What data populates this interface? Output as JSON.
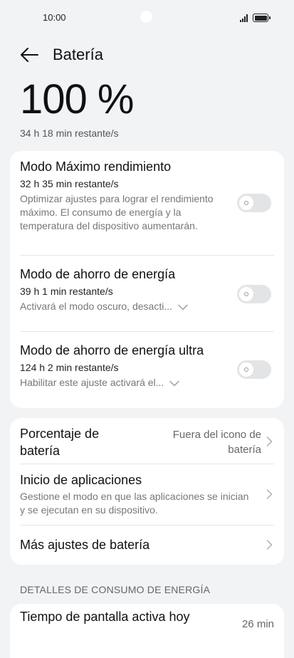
{
  "status_bar": {
    "time": "10:00"
  },
  "header": {
    "title": "Batería"
  },
  "battery": {
    "percent_label": "100 %",
    "remaining": "34 h 18 min restante/s",
    "level_percent": 100
  },
  "modes": [
    {
      "title": "Modo Máximo rendimiento",
      "remaining": "32 h 35 min restante/s",
      "description": "Optimizar ajustes para lograr el rendimiento máximo. El consumo de energía y la temperatura del dispositivo aumentarán.",
      "enabled": false
    },
    {
      "title": "Modo de ahorro de energía",
      "remaining": "39 h 1 min restante/s",
      "description": "Activará el modo oscuro, desacti...",
      "enabled": false
    },
    {
      "title": "Modo de ahorro de energía ultra",
      "remaining": "124 h 2 min restante/s",
      "description": "Habilitar este ajuste activará el...",
      "enabled": false
    }
  ],
  "settings": {
    "percentage": {
      "title": "Porcentaje de batería",
      "value": "Fuera del icono de batería"
    },
    "app_launch": {
      "title": "Inicio de aplicaciones",
      "description": "Gestione el modo en que las aplicaciones se inician y se ejecutan en su dispositivo."
    },
    "more": {
      "title": "Más ajustes de batería"
    }
  },
  "details": {
    "section_title": "DETALLES DE CONSUMO DE ENERGÍA",
    "screen_time": {
      "title": "Tiempo de pantalla activa hoy",
      "value": "26 min"
    }
  }
}
